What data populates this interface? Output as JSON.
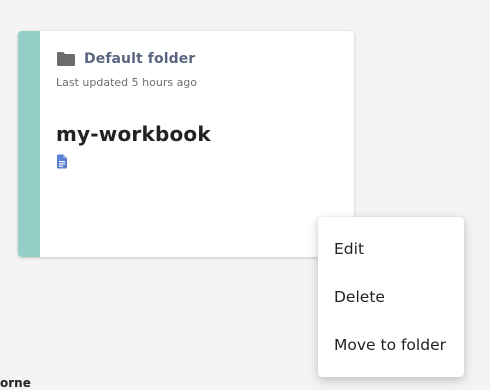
{
  "card": {
    "folder_icon": "folder-icon",
    "folder_name": "Default folder",
    "last_updated": "Last updated 5 hours ago",
    "workbook_title": "my-workbook",
    "doc_icon": "document-icon",
    "accent_color": "#95cec6"
  },
  "menu": {
    "items": [
      {
        "label": "Edit"
      },
      {
        "label": "Delete"
      },
      {
        "label": "Move to folder"
      }
    ]
  },
  "below_fragment": "orne"
}
